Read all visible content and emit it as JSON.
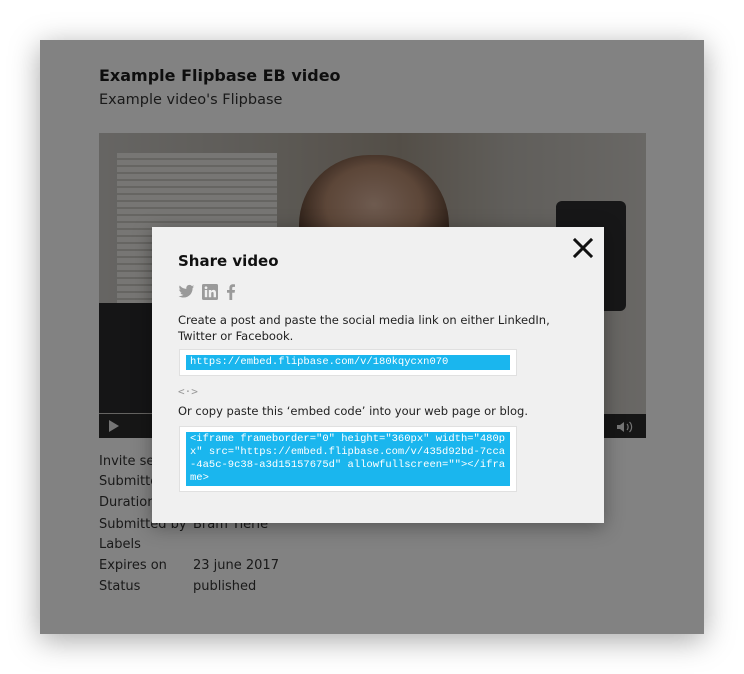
{
  "page": {
    "title": "Example Flipbase EB video",
    "subtitle": "Example video's Flipbase"
  },
  "video": {
    "controls": {
      "play_icon": "play-icon",
      "volume_icon": "volume-icon"
    }
  },
  "metadata": [
    {
      "label": "Invite sen",
      "value": ""
    },
    {
      "label": "Submitted",
      "value": ""
    },
    {
      "label": "Duration",
      "value": ""
    },
    {
      "label": "Submitted by",
      "value": "Bram Tierie"
    },
    {
      "label": "Labels",
      "value": ""
    },
    {
      "label": "Expires on",
      "value": "23 june 2017"
    },
    {
      "label": "Status",
      "value": "published"
    }
  ],
  "modal": {
    "title": "Share video",
    "close_icon": "close-icon",
    "social_icons": [
      "twitter-icon",
      "linkedin-icon",
      "facebook-icon"
    ],
    "social_text": "Create a post and paste the social media link on either LinkedIn, Twitter or Facebook.",
    "share_link": "https://embed.flipbase.com/v/180kqycxn070",
    "embed_icon_glyph": "<·>",
    "embed_text": "Or copy paste this ‘embed code’ into your web page or blog.",
    "embed_code": "<iframe frameborder=\"0\" height=\"360px\" width=\"480px\" src=\"https://embed.flipbase.com/v/435d92bd-7cca-4a5c-9c38-a3d15157675d\" allowfullscreen=\"\"></iframe>"
  },
  "colors": {
    "accent": "#1ab6ee",
    "overlay": "rgba(0,0,0,0.49)",
    "modal_bg": "#f0f0f0"
  }
}
